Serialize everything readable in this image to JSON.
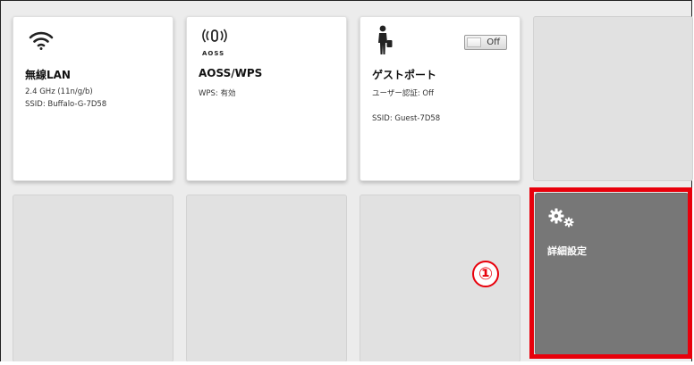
{
  "tiles": {
    "wifi": {
      "title": "無線LAN",
      "line1": "2.4 GHz (11n/g/b)",
      "line2": "SSID: Buffalo-G-7D58",
      "icon": "wifi-icon"
    },
    "aoss": {
      "title": "AOSS/WPS",
      "line1": "WPS: 有効",
      "icon_text": "AOSS",
      "icon": "aoss-icon"
    },
    "guest": {
      "title": "ゲストポート",
      "line1": "ユーザー認証: Off",
      "line2": "SSID: Guest-7D58",
      "toggle_label": "Off",
      "icon": "guest-person-icon"
    },
    "advanced": {
      "title": "詳細設定",
      "icon": "gears-icon"
    }
  },
  "callout": {
    "label": "①"
  },
  "colors": {
    "highlight": "#e8000b",
    "dark_tile": "#777777",
    "white_tile": "#ffffff",
    "empty_tile": "#e1e1e1"
  }
}
